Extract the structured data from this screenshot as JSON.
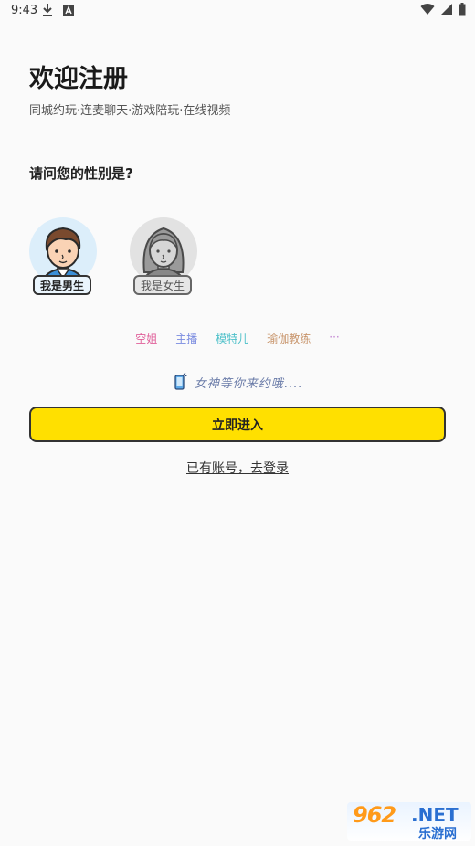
{
  "status_bar": {
    "time": "9:43",
    "left_icons": [
      "download-icon",
      "a-box-icon"
    ],
    "right_icons": [
      "wifi-icon",
      "signal-icon",
      "battery-icon"
    ]
  },
  "header": {
    "title": "欢迎注册",
    "subtitle": "同城约玩·连麦聊天·游戏陪玩·在线视频"
  },
  "gender": {
    "question": "请问您的性别是?",
    "options": [
      {
        "label": "我是男生",
        "avatar": "male-avatar-icon",
        "selected": true
      },
      {
        "label": "我是女生",
        "avatar": "female-avatar-icon",
        "selected": false
      }
    ]
  },
  "tags": [
    "空姐",
    "主播",
    "模特儿",
    "瑜伽教练",
    "···"
  ],
  "promo": {
    "icon": "phone-icon",
    "text": "女神等你来约哦...."
  },
  "buttons": {
    "enter": "立即进入",
    "login": "已有账号，去登录"
  },
  "watermark": {
    "main": "962",
    "net": ".NET",
    "sub": "乐游网"
  },
  "colors": {
    "accent": "#ffe000",
    "background": "#fafafa",
    "male_avatar_bg": "#dceefa",
    "female_avatar_bg": "#e2e2e2"
  }
}
